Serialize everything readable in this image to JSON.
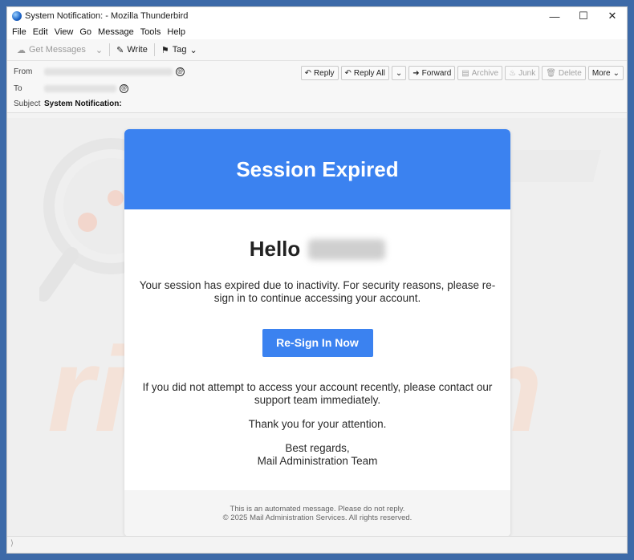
{
  "window": {
    "title": "System Notification: - Mozilla Thunderbird"
  },
  "menu": [
    "File",
    "Edit",
    "View",
    "Go",
    "Message",
    "Tools",
    "Help"
  ],
  "toolbar": {
    "get_messages": "Get Messages",
    "write": "Write",
    "tag": "Tag"
  },
  "header": {
    "from_label": "From",
    "to_label": "To",
    "subject_label": "Subject",
    "subject_value": "System Notification:",
    "buttons": {
      "reply": "Reply",
      "reply_all": "Reply All",
      "forward": "Forward",
      "archive": "Archive",
      "junk": "Junk",
      "delete": "Delete",
      "more": "More"
    }
  },
  "email": {
    "banner_title": "Session Expired",
    "greeting": "Hello",
    "paragraph1": "Your session has expired due to inactivity. For security reasons, please re-sign in to continue accessing your account.",
    "cta_label": "Re-Sign In Now",
    "paragraph2": "If you did not attempt to access your account recently, please contact our support team immediately.",
    "thanks": "Thank you for your attention.",
    "regards": "Best regards,",
    "signature": "Mail Administration Team",
    "footer_line1": "This is an automated message. Please do not reply.",
    "footer_line2": "© 2025 Mail Administration Services. All rights reserved."
  },
  "colors": {
    "accent": "#3b82f0",
    "desktop": "#3d6aa8"
  }
}
